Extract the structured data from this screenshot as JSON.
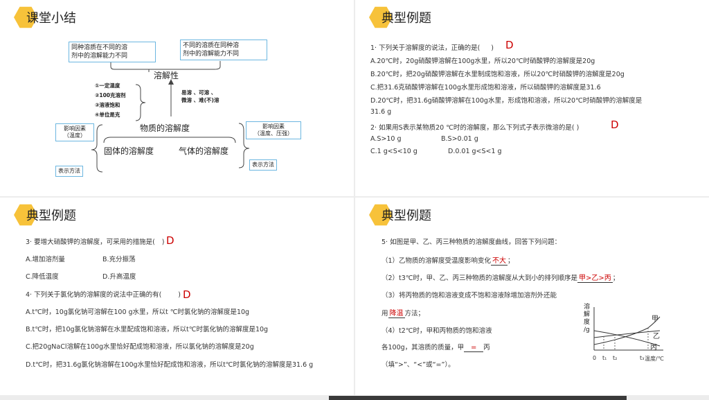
{
  "p1": {
    "title": "课堂小结",
    "box1": [
      "同种溶质在不同的溶",
      "剂中的溶解能力不同"
    ],
    "box2": [
      "不同的溶质在同种溶",
      "剂中的溶解能力不同"
    ],
    "solubility_label": "溶解性",
    "conditions": [
      "①一定温度",
      "②100克溶剂",
      "③溶液饱和",
      "④单位是克"
    ],
    "levels": [
      "易溶 、可溶 、",
      "微溶 、难(不)溶"
    ],
    "substance_solubility": "物质的溶解度",
    "factor_solid": [
      "影响因素",
      "（温度）"
    ],
    "solid_label": "固体的溶解度",
    "gas_label": "气体的溶解度",
    "factor_gas": [
      "影响因素",
      "（温度、压强）"
    ],
    "repr_left": "表示方法",
    "repr_right": "表示方法"
  },
  "p2": {
    "title": "典型例题",
    "q1": "1· 下列关于溶解度的说法，正确的是(",
    "q1_ans": "D",
    "q1_close": ")",
    "a": "A.20℃时，20g硝酸钾溶解在100g水里，所以20℃时硝酸钾的溶解度是20g",
    "b": "B.20℃时，把20g硝酸钾溶解在水里制成饱和溶液，所以20℃时硝酸钾的溶解度是20g",
    "c": "C.把31.6克硝酸钾溶解在100g水里形成饱和溶液，所以硝酸钾的溶解度是31.6",
    "d1": "D.20℃时，把31.6g硝酸钾溶解在100g水里，形成饱和溶液，所以20℃时硝酸钾的溶解度是",
    "d2": "31.6 g",
    "q2": "2· 如果用S表示某物质20 ℃时的溶解度，那么下列式子表示微溶的是(  )",
    "q2_ans": "D",
    "q2a": "A.S>10 g",
    "q2b": "B.S>0.01 g",
    "q2c": "C.1 g<S<10 g",
    "q2d": "D.0.01 g<S<1 g"
  },
  "p3": {
    "title": "典型例题",
    "q3": "3· 要增大硝酸钾的溶解度，可采用的措施是(",
    "q3_ans": "D",
    "q3_close": ")",
    "q3a": "A.增加溶剂量",
    "q3b": "B.充分振荡",
    "q3c": "C.降低温度",
    "q3d": "D.升高温度",
    "q4": "4· 下列关于氯化钠的溶解度的说法中正确的有(",
    "q4_ans": "D",
    "q4_close": ")",
    "q4a": "A.t℃时，10g氯化钠可溶解在100 g水里，所以t ℃时氯化钠的溶解度是10g",
    "q4b": "B.t℃时，把10g氯化钠溶解在水里配成饱和溶液，所以t℃时氯化钠的溶解度是10g",
    "q4c": "C.把20gNaCl溶解在100g水里恰好配成饱和溶液，所以氯化钠的溶解度是20g",
    "q4d": "D.t℃时，把31.6g氯化钠溶解在100g水里恰好配成饱和溶液，所以t℃时氯化钠的溶解度是31.6 g"
  },
  "p4": {
    "title": "典型例题",
    "q5": "5· 如图是甲、乙、丙三种物质的溶解度曲线，回答下列问题：",
    "s1_pre": "（1）乙物质的溶解度受温度影响变化",
    "s1_ans": "不大",
    "s1_post": "；",
    "s2_pre": "（2）t3℃时，甲、乙、丙三种物质的溶解度从大到小的排列顺序是",
    "s2_ans": "甲>乙>丙",
    "s2_post": "；",
    "s3": "（3）将丙物质的饱和溶液变成不饱和溶液除增加溶剂外还能",
    "s3b_pre": "用",
    "s3b_ans": "降温",
    "s3b_post": "方法；",
    "s4": "（4）t2℃时，甲和丙物质的饱和溶液",
    "s4b_pre": "各100g，其溶质的质量，甲",
    "s4b_ans": "=",
    "s4b_post": "丙",
    "s4c": "（填“>”、“<”或“=”）。",
    "graph": {
      "ylabel": [
        "溶",
        "解",
        "度",
        "/g"
      ],
      "curve_jia": "甲",
      "curve_yi": "乙",
      "curve_bing": "丙",
      "origin": "0",
      "t1": "t₁",
      "t2": "t₂",
      "t3": "t₃",
      "xlabel": "温度/℃"
    }
  }
}
